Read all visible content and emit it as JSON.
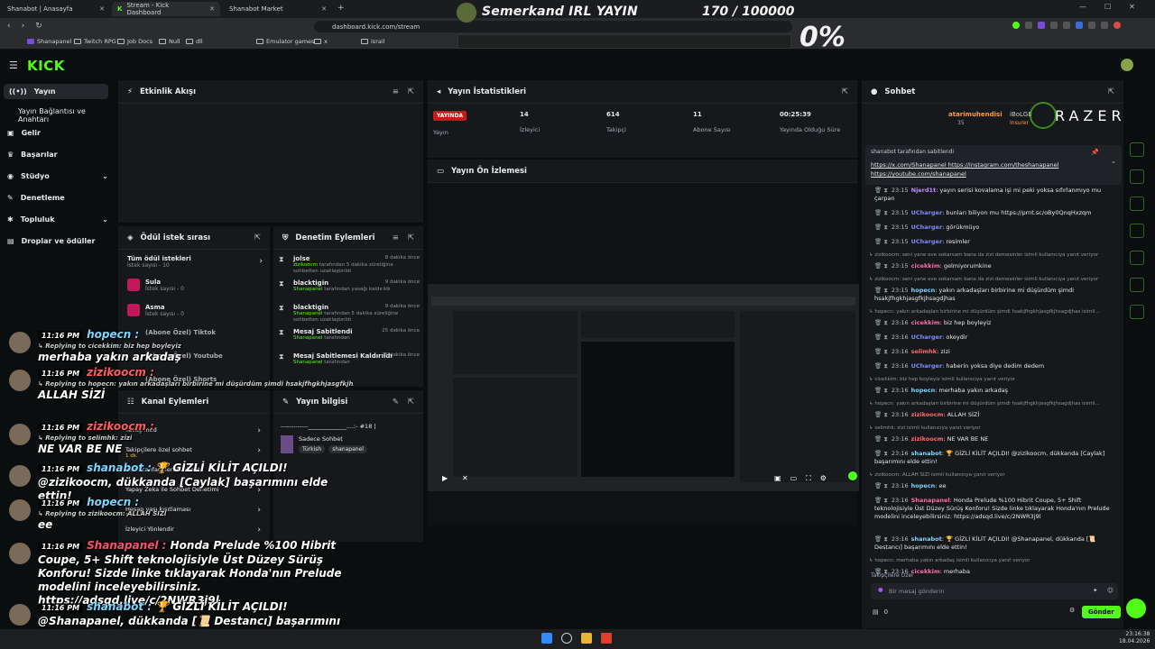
{
  "browser": {
    "tabs": [
      {
        "label": "Shanabot | Anasayfa"
      },
      {
        "label": "Stream - Kick Dashboard"
      },
      {
        "label": "Shanabot Market"
      }
    ],
    "url": "dashboard.kick.com/stream",
    "bookmarks": [
      "Shanapanel",
      "Twitch RPG",
      "Job Docs",
      "Null",
      "dll",
      "Emulator games",
      "x",
      "israil"
    ]
  },
  "stream_overlay": {
    "title": "Semerkand IRL YAYIN",
    "count": "170 / 100000",
    "percent": "0%"
  },
  "kick": {
    "logo": "KICK",
    "nav": [
      {
        "label": "Yayın"
      },
      {
        "label": "Yayın Bağlantısı ve Anahtarı"
      },
      {
        "label": "Gelir"
      },
      {
        "label": "Başarılar"
      },
      {
        "label": "Stüdyo"
      },
      {
        "label": "Denetleme"
      },
      {
        "label": "Topluluk"
      },
      {
        "label": "Droplar ve ödüller"
      }
    ]
  },
  "activity": {
    "title": "Etkinlik Akışı"
  },
  "stats": {
    "title": "Yayın İstatistikleri",
    "live_badge": "YAYINDA",
    "items": [
      {
        "value": "",
        "label": "Yayın"
      },
      {
        "value": "14",
        "label": "İzleyici"
      },
      {
        "value": "614",
        "label": "Takipçi"
      },
      {
        "value": "11",
        "label": "Abone Sayısı"
      },
      {
        "value": "00:25:39",
        "label": "Yayında Olduğu Süre"
      }
    ]
  },
  "preview": {
    "title": "Yayın Ön İzlemesi"
  },
  "rewards": {
    "title": "Ödül istek sırası",
    "items": [
      {
        "name": "Tüm ödül istekleri",
        "sub": "İstek sayısı - 10"
      },
      {
        "name": "Sula",
        "sub": "İstek sayısı - 0"
      },
      {
        "name": "Asma",
        "sub": "İstek sayısı - 0"
      },
      {
        "name": "(Abone Özel) Tiktok",
        "sub": ""
      },
      {
        "name": "(Abone Özel) Youtube",
        "sub": ""
      },
      {
        "name": "(Abone Özel) Shorts",
        "sub": ""
      }
    ]
  },
  "modactions": {
    "title": "Denetim Eylemleri",
    "items": [
      {
        "user": "jolse",
        "time": "8 dakika önce",
        "actor": "zizikoocm",
        "desc": "tarafından 5 dakika süreliğine sohbetten uzaklaştırıldı"
      },
      {
        "user": "blacktigin",
        "time": "9 dakika önce",
        "actor": "Shanapanel",
        "desc": "tarafından yasağı kaldırıldı"
      },
      {
        "user": "blacktigin",
        "time": "9 dakika önce",
        "actor": "Shanapanel",
        "desc": "tarafından 5 dakika süreliğine sohbetten uzaklaştırıldı"
      },
      {
        "user": "Mesaj Sabitlendi",
        "time": "25 dakika önce",
        "actor": "Shanapanel",
        "desc": "tarafından"
      },
      {
        "user": "Mesaj Sabitlemesi Kaldırıldı",
        "time": "25 dakika önce",
        "actor": "Shanapanel",
        "desc": "tarafından"
      }
    ]
  },
  "channelactions": {
    "title": "Kanal Eylemleri",
    "items": [
      {
        "name": "Yavaş mod",
        "sub": ""
      },
      {
        "name": "Takipçilere özel sohbet",
        "sub": "1 dk."
      },
      {
        "name": "Yalnızca ifadelerle sohbet",
        "sub": ""
      },
      {
        "name": "Yapay Zeka ile Sohbet Denetimi",
        "sub": ""
      },
      {
        "name": "Hesap yaşı kısıtlaması",
        "sub": "1 hf."
      },
      {
        "name": "İzleyici Yönlendir",
        "sub": ""
      }
    ]
  },
  "streaminfo": {
    "title": "Yayın bilgisi",
    "stream_title": "-------------_____________....:- #18 |",
    "category": "Sadece Sohbet",
    "tags": [
      "Türkish",
      "shanapanel"
    ]
  },
  "chat": {
    "title": "Sohbet",
    "top_user": "atarimuhendisi",
    "top_user_count": "35",
    "second_user": "iBoLGE",
    "second_user_role": "Insurer",
    "sponsor": "RAZER",
    "pinned": {
      "by": "shanabot tarafından sabitlendi",
      "line1": "https://x.com/Shanapanel https://instagram.com/theshanapanel",
      "line2": "https://youtube.com/shanapanel"
    },
    "messages": [
      {
        "time": "23:15",
        "user": "Njerd1t",
        "color": "#c48bff",
        "text": "yayın serisi kovalama işi mi peki yoksa sıfırlanmıyo mu çarpan"
      },
      {
        "time": "23:15",
        "user": "UCharger",
        "color": "#7b8cff",
        "text": "bunları biliyon mu https://prnt.sc/oBy0QnqHxzqm"
      },
      {
        "time": "23:15",
        "user": "UCharger",
        "color": "#7b8cff",
        "text": "görükmüyo"
      },
      {
        "time": "23:15",
        "user": "UCharger",
        "color": "#7b8cff",
        "text": "resimler"
      },
      {
        "sys": "zizikoocm: seni yane eve sokarsam bana da zizi demesinler isimli kullanıcıya yanıt veriyor"
      },
      {
        "time": "23:15",
        "user": "cicekkim",
        "color": "#ff6bb0",
        "text": "gelmiyorumkine"
      },
      {
        "sys": "zizikoocm: seni yane eve sokarsam bana da zizi demesinler isimli kullanıcıya yanıt veriyor"
      },
      {
        "time": "23:15",
        "user": "hopecn",
        "color": "#7ad7ff",
        "text": "yakın arkadaşları birbirine mi düşürdüm şimdi hsakjfhgkhjasgfkjhsagdjhas"
      },
      {
        "sys": "hopecn: yakın arkadaşları birbirine mi düşürdüm şimdi hsakjfhgkhjasgfkjhsagdjhas isimli..."
      },
      {
        "time": "23:16",
        "user": "cicekkim",
        "color": "#ff6bb0",
        "text": "biz hep boyleyiz"
      },
      {
        "time": "23:16",
        "user": "UCharger",
        "color": "#7b8cff",
        "text": "okeydir"
      },
      {
        "time": "23:16",
        "user": "selimhk",
        "color": "#ff6b6b",
        "text": "zizi"
      },
      {
        "time": "23:16",
        "user": "UCharger",
        "color": "#7b8cff",
        "text": "haberin yoksa diye dedim dedem"
      },
      {
        "sys": "cicekkim: biz hep boyleyiz isimli kullanıcıya yanıt veriyor"
      },
      {
        "time": "23:16",
        "user": "hopecn",
        "color": "#7ad7ff",
        "text": "merhaba yakın arkadaş"
      },
      {
        "sys": "hopecn: yakın arkadaşları birbirine mi düşürdüm şimdi hsakjfhgkhjasgfkjhsagdjhas isimli..."
      },
      {
        "time": "23:16",
        "user": "zizikoocm",
        "color": "#ff6b6b",
        "text": "ALLAH SİZİ"
      },
      {
        "sys": "selimhk: zizi isimli kullanıcıya yanıt veriyor"
      },
      {
        "time": "23:16",
        "user": "zizikoocm",
        "color": "#ff6b6b",
        "text": "NE VAR BE NE"
      },
      {
        "time": "23:16",
        "user": "shanabot",
        "color": "#7ad7ff",
        "text": "🏆 GİZLİ KİLİT AÇILDI! @zizikoocm, dükkanda [Caylak] başarımını elde ettin!"
      },
      {
        "sys": "zizikoocm: ALLAH SİZİ isimli kullanıcıya yanıt veriyor"
      },
      {
        "time": "23:16",
        "user": "hopecn",
        "color": "#7ad7ff",
        "text": "ee"
      },
      {
        "time": "23:16",
        "user": "Shanapanel",
        "color": "#ff6b9d",
        "text": "Honda Prelude %100 Hibrit Coupe, 5+ Shift teknolojisiyle Üst Düzey Sürüş Konforu! Sizde linke tıklayarak Honda'nın Prelude modelini inceleyebilirsiniz. https://adsqd.live/c/2NWR3j9l"
      },
      {
        "time": "23:16",
        "user": "shanabot",
        "color": "#7ad7ff",
        "text": "🏆 GİZLİ KİLİT AÇILDI! @Shanapanel, dükkanda [📜 Destancı] başarımını elde ettin!"
      },
      {
        "sys": "hopecn: merhaba yakın arkadaş isimli kullanıcıya yanıt veriyor"
      },
      {
        "time": "23:16",
        "user": "cicekkim",
        "color": "#ff6bb0",
        "text": "merhaba"
      }
    ],
    "followers_only": "Takipçilere Özel",
    "input_placeholder": "Bir mesaj gönderin",
    "count": "0",
    "send": "Gönder"
  },
  "overlay_chat": [
    {
      "time": "11:16 PM",
      "user": "hopecn",
      "color": "#7ad7ff",
      "reply": "Replying to cicekkim: biz hep boyleyiz",
      "text": "merhaba yakın arkadaş"
    },
    {
      "time": "11:16 PM",
      "user": "zizikoocm",
      "color": "#ff5c5c",
      "reply": "Replying to hopecn: yakın arkadaşları birbirine mi düşürdüm şimdi hsakjfhgkhjasgfkjhsagdjhas",
      "text": "ALLAH SİZİ"
    },
    {
      "time": "11:16 PM",
      "user": "zizikoocm",
      "color": "#ff5c5c",
      "reply": "Replying to selimhk: zizi",
      "text": "NE VAR BE NE"
    },
    {
      "time": "11:16 PM",
      "user": "shanabot",
      "color": "#7ad7ff",
      "reply": "",
      "text": "🏆 GİZLİ KİLİT AÇILDI! @zizikoocm, dükkanda [Caylak] başarımını elde ettin!"
    },
    {
      "time": "11:16 PM",
      "user": "hopecn",
      "color": "#7ad7ff",
      "reply": "Replying to zizikoocm: ALLAH SİZİ",
      "text": "ee"
    },
    {
      "time": "11:16 PM",
      "user": "Shanapanel",
      "color": "#ff4f6d",
      "reply": "",
      "text": "Honda Prelude %100 Hibrit Coupe, 5+ Shift teknolojisiyle Üst Düzey Sürüş Konforu! Sizde linke tıklayarak Honda'nın Prelude modelini inceleyebilirsiniz. https://adsqd.live/c/2NWR3j9l"
    },
    {
      "time": "11:16 PM",
      "user": "shanabot",
      "color": "#7ad7ff",
      "reply": "",
      "text": "🏆 GİZLİ KİLİT AÇILDI! @Shanapanel, dükkanda [📜 Destancı] başarımını elde ettin!"
    }
  ],
  "taskbar": {
    "clock": "23:16:38",
    "date": "18.04.2026"
  }
}
